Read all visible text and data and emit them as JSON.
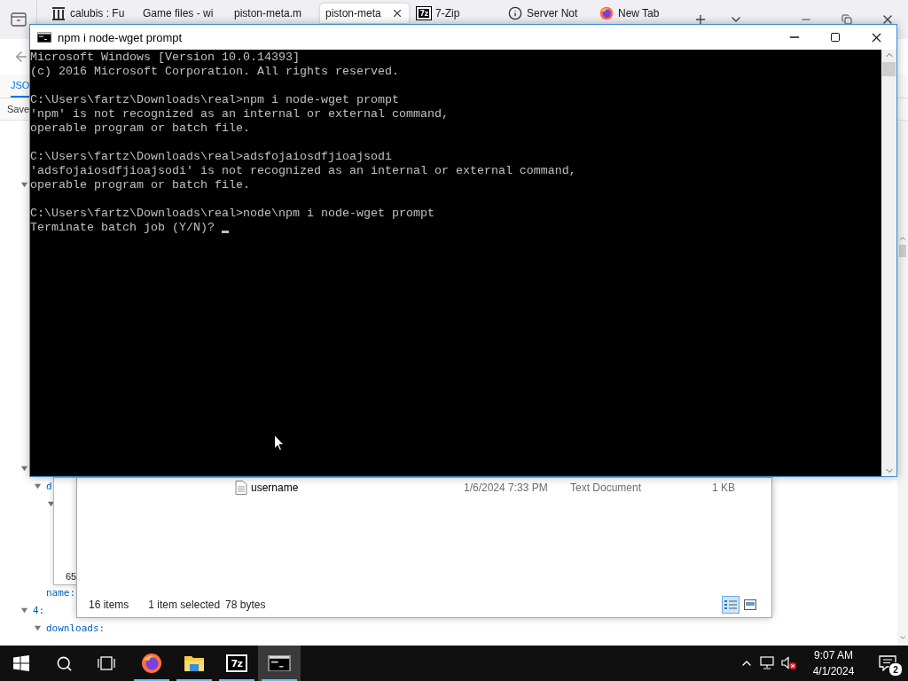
{
  "browser": {
    "tabs": [
      {
        "label": "calubis : Fu",
        "kind": "library",
        "selected": false
      },
      {
        "label": "Game files - wi",
        "kind": "plain",
        "selected": false
      },
      {
        "label": "piston-meta.m",
        "kind": "plain",
        "selected": false
      },
      {
        "label": "piston-meta",
        "kind": "plain",
        "selected": true
      },
      {
        "label": "7-Zip",
        "kind": "sevenzip",
        "icon_text": "7z",
        "selected": false
      },
      {
        "label": "Server Not",
        "kind": "info",
        "selected": false
      },
      {
        "label": "New Tab",
        "kind": "firefox",
        "selected": false
      }
    ],
    "json_viewer": {
      "tabs": [
        {
          "label": "JSO",
          "selected": true
        }
      ],
      "toolbar": [
        "Save"
      ],
      "tree": [
        {
          "expanded": true
        },
        {
          "expanded": true,
          "children": [
            {
              "label": "d",
              "expanded": true,
              "children": [
                {
                  "expanded": true
                }
              ]
            },
            {
              "label": "name:"
            }
          ]
        },
        {
          "label": "4:",
          "expanded": true,
          "children": [
            {
              "label": "downloads:",
              "expanded": true
            }
          ]
        }
      ]
    }
  },
  "back_window": {
    "text": "65"
  },
  "explorer": {
    "files": [
      {
        "name": "username",
        "modified": "1/6/2024 7:33 PM",
        "type": "Text Document",
        "size": "1 KB"
      }
    ],
    "status": {
      "count": "16 items",
      "selection": "1 item selected",
      "size": "78 bytes"
    },
    "views": [
      {
        "kind": "details",
        "selected": true
      },
      {
        "kind": "tiles",
        "selected": false
      }
    ]
  },
  "console_window": {
    "title": "npm i node-wget prompt",
    "blocks": [
      [
        "Microsoft Windows [Version 10.0.14393]",
        "(c) 2016 Microsoft Corporation. All rights reserved."
      ],
      [
        "C:\\Users\\fartz\\Downloads\\real>npm i node-wget prompt",
        "'npm' is not recognized as an internal or external command,",
        "operable program or batch file."
      ],
      [
        "C:\\Users\\fartz\\Downloads\\real>adsfojaiosdfjioajsodi",
        "'adsfojaiosdfjioajsodi' is not recognized as an internal or external command,",
        "operable program or batch file."
      ],
      [
        "C:\\Users\\fartz\\Downloads\\real>node\\npm i node-wget prompt",
        "Terminate batch job (Y/N)? "
      ]
    ]
  },
  "taskbar": {
    "apps": [
      {
        "kind": "firefox",
        "running": true,
        "selected": false
      },
      {
        "kind": "explorer",
        "running": true,
        "selected": false
      },
      {
        "kind": "sevenzip",
        "label": "7z",
        "running": true,
        "selected": false
      },
      {
        "kind": "cmd",
        "running": true,
        "selected": true
      }
    ],
    "volume_muted": true,
    "clock": {
      "time": "9:07 AM",
      "date": "4/1/2024"
    },
    "notifications": "2"
  }
}
